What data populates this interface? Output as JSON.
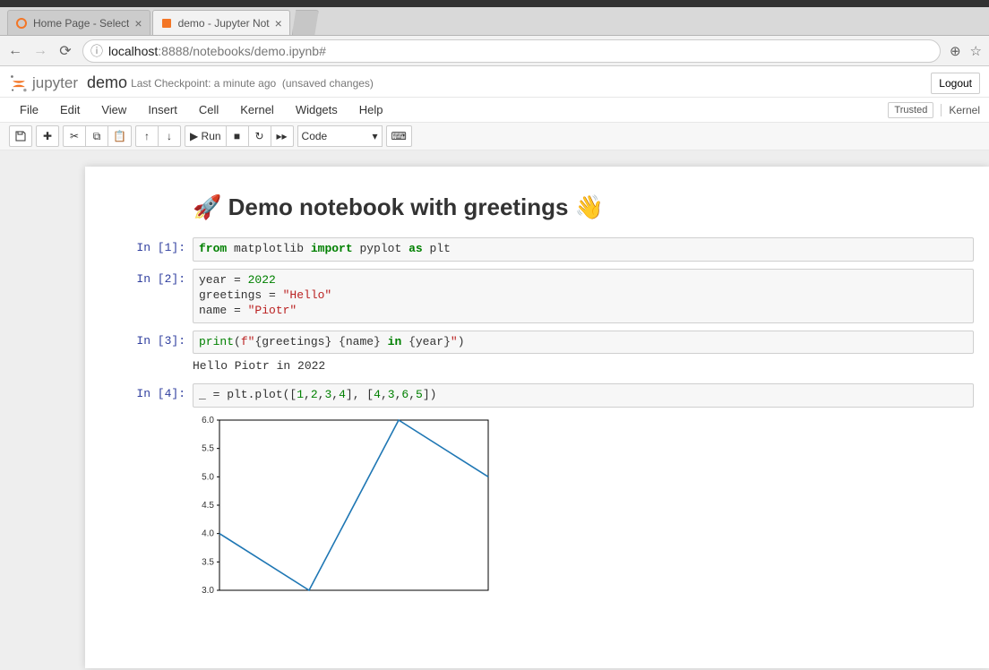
{
  "browser": {
    "tabs": [
      {
        "title": "Home Page - Select",
        "active": false
      },
      {
        "title": "demo - Jupyter Not",
        "active": true
      }
    ],
    "url_host": "localhost",
    "url_port": ":8888",
    "url_path": "/notebooks/demo.ipynb#"
  },
  "header": {
    "logo_text": "jupyter",
    "notebook_name": "demo",
    "checkpoint": "Last Checkpoint: a minute ago",
    "unsaved": "(unsaved changes)",
    "logout": "Logout"
  },
  "menus": [
    "File",
    "Edit",
    "View",
    "Insert",
    "Cell",
    "Kernel",
    "Widgets",
    "Help"
  ],
  "trusted": "Trusted",
  "kernel_label": "Kernel",
  "toolbar": {
    "run_label": "Run",
    "celltype": "Code"
  },
  "cells": {
    "md_title": "🚀 Demo notebook with greetings 👋",
    "p1": "In [1]:",
    "p2": "In [2]:",
    "p3": "In [3]:",
    "p4": "In [4]:",
    "out3": "Hello Piotr in 2022"
  },
  "chart_data": {
    "type": "line",
    "x": [
      1,
      2,
      3,
      4
    ],
    "y": [
      4,
      3,
      6,
      5
    ],
    "xlim": [
      1,
      4
    ],
    "ylim": [
      3,
      6
    ],
    "yticks": [
      3.0,
      3.5,
      4.0,
      4.5,
      5.0,
      5.5,
      6.0
    ],
    "series_color": "#1f77b4"
  }
}
